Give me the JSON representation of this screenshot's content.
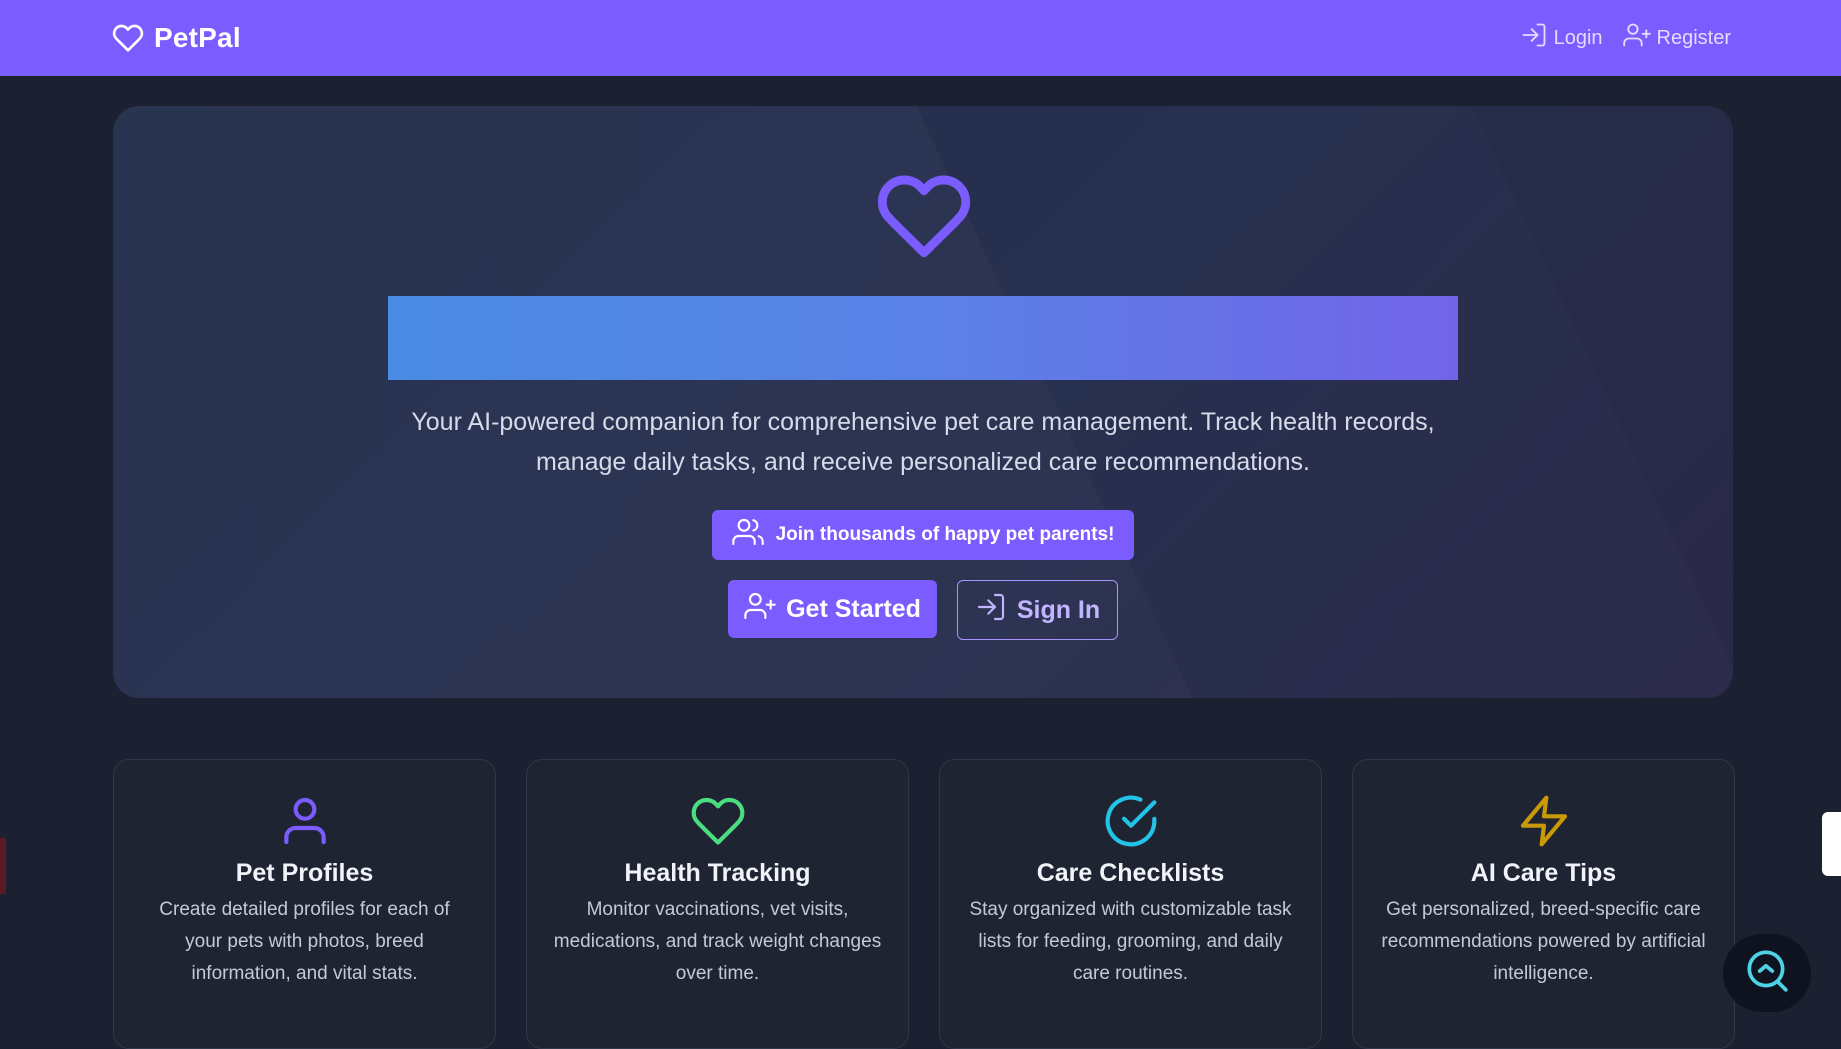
{
  "navbar": {
    "brand": "PetPal",
    "links": [
      {
        "label": "Login",
        "icon": "login-icon"
      },
      {
        "label": "Register",
        "icon": "user-plus-icon"
      }
    ]
  },
  "hero": {
    "icon": "heart-icon",
    "description": "Your AI-powered companion for comprehensive pet care management. Track health records, manage daily tasks, and receive personalized care recommendations.",
    "badge": "Join thousands of happy pet parents!",
    "primary_button": "Get Started",
    "secondary_button": "Sign In"
  },
  "features": [
    {
      "title": "Pet Profiles",
      "text": "Create detailed profiles for each of your pets with photos, breed information, and vital stats.",
      "icon": "user-icon",
      "color": "#7a5cff"
    },
    {
      "title": "Health Tracking",
      "text": "Monitor vaccinations, vet visits, medications, and track weight changes over time.",
      "icon": "heart-icon",
      "color": "#4ade80"
    },
    {
      "title": "Care Checklists",
      "text": "Stay organized with customizable task lists for feeding, grooming, and daily care routines.",
      "icon": "check-circle-icon",
      "color": "#22c3e6"
    },
    {
      "title": "AI Care Tips",
      "text": "Get personalized, breed-specific care recommendations powered by artificial intelligence.",
      "icon": "lightning-icon",
      "color": "#c99a06"
    }
  ],
  "colors": {
    "accent": "#7a5cff",
    "background": "#1b2130"
  }
}
